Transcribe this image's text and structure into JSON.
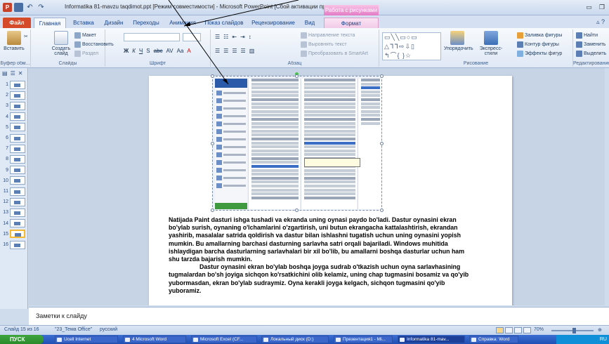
{
  "window": {
    "title": "Informatika 81-mavzu taqdimot.ppt [Режим совместимости] - Microsoft PowerPoint [Сбой активации про...",
    "context_tab_header": "Работа с рисунками"
  },
  "ribbon_tabs": [
    {
      "label": "Файл"
    },
    {
      "label": "Главная"
    },
    {
      "label": "Вставка"
    },
    {
      "label": "Дизайн"
    },
    {
      "label": "Переходы"
    },
    {
      "label": "Анимация"
    },
    {
      "label": "Показ слайдов"
    },
    {
      "label": "Рецензирование"
    },
    {
      "label": "Вид"
    },
    {
      "label": "Формат"
    }
  ],
  "ribbon": {
    "clipboard": {
      "paste": "Вставить",
      "label": "Буфер обм..."
    },
    "slides": {
      "new_slide": "Создать слайд",
      "layout": "Макет",
      "reset": "Восстановить",
      "section": "Раздел",
      "label": "Слайды"
    },
    "font": {
      "label": "Шрифт"
    },
    "paragraph": {
      "direction": "Направление текста",
      "align": "Выровнять текст",
      "smartart": "Преобразовать в SmartArt",
      "label": "Абзац"
    },
    "drawing": {
      "arrange": "Упорядочить",
      "quick_styles": "Экспресс-стили",
      "fill": "Заливка фигуры",
      "outline": "Контур фигуры",
      "effects": "Эффекты фигур",
      "label": "Рисование"
    },
    "editing": {
      "find": "Найти",
      "replace": "Заменить",
      "select": "Выделить",
      "label": "Редактирование"
    }
  },
  "slide_panel": {
    "numbers": [
      "1",
      "2",
      "3",
      "4",
      "5",
      "6",
      "7",
      "8",
      "9",
      "10",
      "11",
      "12",
      "13",
      "14",
      "15",
      "16"
    ],
    "selected": "15"
  },
  "slide": {
    "paragraph1": "Natijada Paint dasturi ishga tushadi va ekranda uning oynasi paydo bo'ladi. Dastur oynasini ekran bo'ylab surish, oynaning o'lchamlarini o'zgartirish, uni butun ekrangacha kattalashtirish, ekrandan yashirib, masalalar satrida qoldirish va dastur bilan ishlashni tugatish uchun uning oynasini yopish mumkin. Bu amallarning barchasi dasturning sarlavha satri orqali bajariladi. Windows muhitida ishlaydigan barcha dasturlarning sarlavhalari bir xil bo'lib, bu amallarni boshqa dasturlar uchun ham shu tarzda bajarish mumkin.",
    "paragraph2": "Dastur oynasini ekran bo'ylab boshqa joyga sudrab o'tkazish uchun oyna sarlavhasining tugmalardan bo'sh joyiga sichqon ko'rsatkichini olib kelamiz, uning chap tugmasini bosamiz va qo'yib yubormasdan, ekran bo'ylab sudraymiz. Oyna kerakli joyga kelgach, sichqon tugmasini qo'yib yuboramiz."
  },
  "notes": {
    "placeholder": "Заметки к слайду"
  },
  "status": {
    "slide_info": "Слайд 15 из 16",
    "theme": "\"23_Тема Office\"",
    "language": "русский",
    "zoom": "70%"
  },
  "taskbar": {
    "start": "ПУСК",
    "tasks": [
      "Ucell Internet",
      "4 Microsoft Word",
      "Microsoft Excel (CF...",
      "Локальный диск (D:)",
      "Презентация1 - Mi...",
      "Informatika 81-mav...",
      "Справка: Word"
    ],
    "tray": "RU"
  },
  "colors": {
    "accent": "#d54b29",
    "context_tab": "#e37bc4",
    "ribbon_bg": "#dfe8f5"
  }
}
